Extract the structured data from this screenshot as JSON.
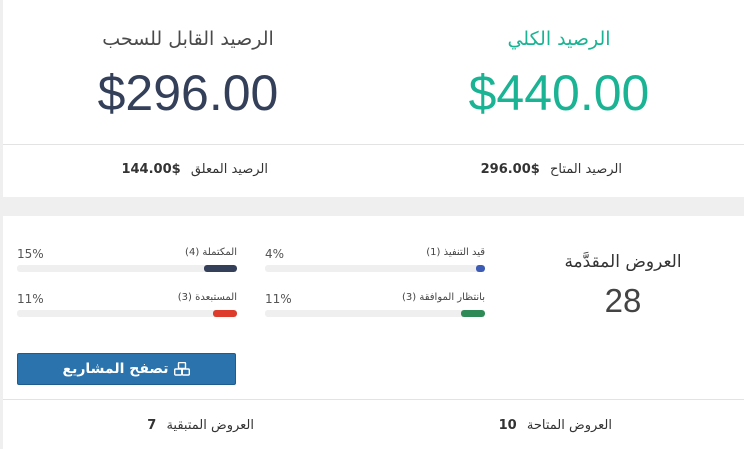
{
  "balance": {
    "total_title": "الرصيد الكلي",
    "total_amount": "$440.00",
    "withdrawable_title": "الرصيد القابل للسحب",
    "withdrawable_amount": "$296.00",
    "available_label": "الرصيد المتاح",
    "available_value": "$296.00",
    "pending_label": "الرصيد المعلق",
    "pending_value": "$144.00"
  },
  "offers": {
    "title": "العروض المقدَّمة",
    "count": "28",
    "stats": [
      {
        "name": "قيد التنفيذ (1)",
        "percent_label": "4%",
        "percent": 4,
        "color": "#3b5bb5"
      },
      {
        "name": "المكتملة (4)",
        "percent_label": "15%",
        "percent": 15,
        "color": "#34405a"
      },
      {
        "name": "بانتظار الموافقة (3)",
        "percent_label": "11%",
        "percent": 11,
        "color": "#2e8b57"
      },
      {
        "name": "المستبعدة (3)",
        "percent_label": "11%",
        "percent": 11,
        "color": "#dd3b2c"
      }
    ],
    "browse_button": "تصفح المشاريع",
    "available_label": "العروض المتاحة",
    "available_value": "10",
    "remaining_label": "العروض المتبقية",
    "remaining_value": "7"
  }
}
